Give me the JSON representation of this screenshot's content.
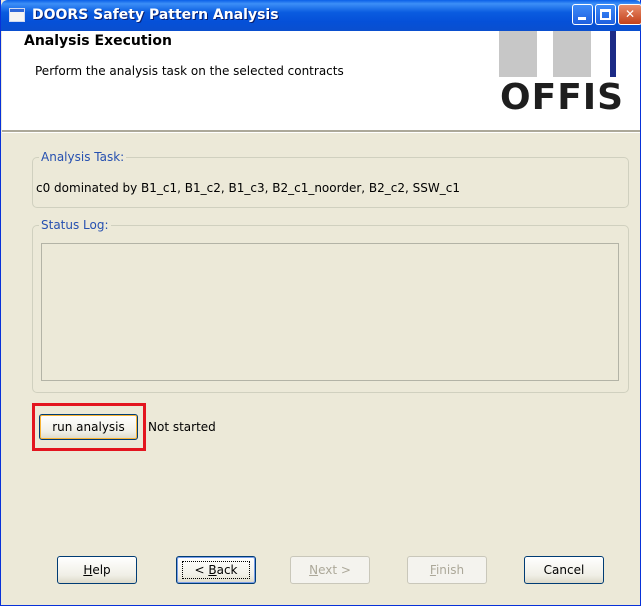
{
  "window": {
    "title": "DOORS Safety Pattern Analysis",
    "controls": {
      "minimize": "minimize-icon",
      "maximize": "maximize-icon",
      "close": "close-icon"
    }
  },
  "header": {
    "title": "Analysis Execution",
    "description": "Perform the analysis task on the selected contracts",
    "logo_text": "OFFIS"
  },
  "analysis_task": {
    "legend": "Analysis Task:",
    "text": "c0 dominated by B1_c1, B1_c2, B1_c3, B2_c1_noorder, B2_c2, SSW_c1"
  },
  "status_log": {
    "legend": "Status Log:",
    "content": ""
  },
  "run": {
    "button_label": "run analysis",
    "status": "Not started",
    "highlight_color": "#e3151f"
  },
  "buttons": {
    "help": {
      "accel": "H",
      "rest": "elp"
    },
    "back": {
      "prefix": "< ",
      "accel": "B",
      "rest": "ack"
    },
    "next": {
      "accel": "N",
      "rest": "ext >"
    },
    "finish": {
      "accel": "F",
      "rest": "inish"
    },
    "cancel": "Cancel"
  }
}
